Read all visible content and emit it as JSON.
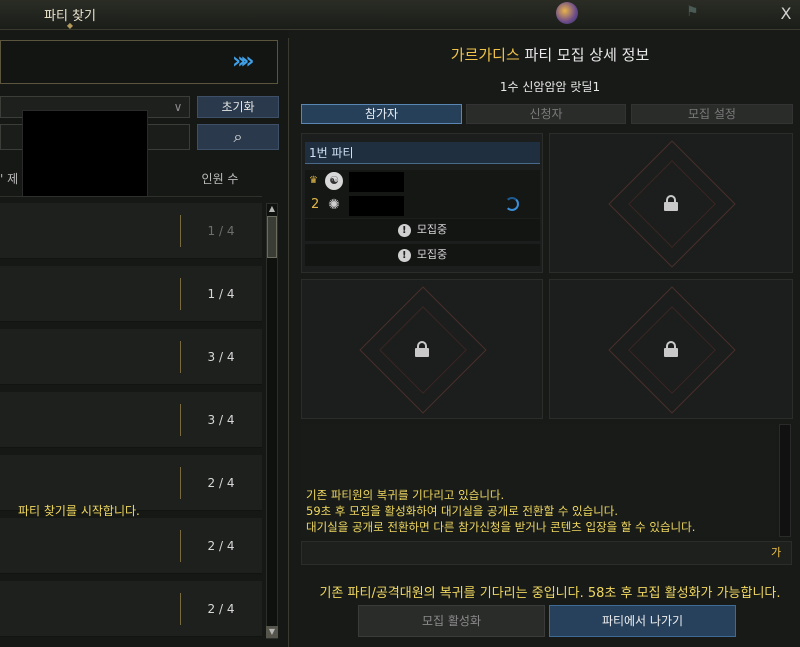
{
  "window": {
    "title": "파티 찾기",
    "title_ornament": "◆",
    "close_label": "X",
    "map_pin_glyph": "⚑"
  },
  "left": {
    "search_arrow": "»»",
    "reset_label": "초기화",
    "search_icon": "⌕",
    "filter_chevron": "∨",
    "col_title_fragment": "' 제",
    "col_members": "인원 수",
    "rows": [
      {
        "count": "1 / 4",
        "dim": true
      },
      {
        "count": "1 / 4",
        "dim": false
      },
      {
        "count": "3 / 4",
        "dim": false
      },
      {
        "count": "3 / 4",
        "dim": false
      },
      {
        "count": "2 / 4",
        "dim": false
      },
      {
        "count": "2 / 4",
        "dim": false
      },
      {
        "count": "2 / 4",
        "dim": false
      }
    ],
    "start_message": "파티 찾기를 시작합니다.",
    "scroll_up": "▲",
    "scroll_down": "▼"
  },
  "detail": {
    "title_accent": "가르가디스",
    "title_rest": " 파티 모집 상세 정보",
    "party_name": "1수 신암암암 랏딜1",
    "tabs": {
      "participants": "참가자",
      "applicants": "신청자",
      "settings": "모집 설정"
    },
    "party1": {
      "header": "1번 파티",
      "crown": "♛",
      "class_icon_1": "☯",
      "member2_number": "2",
      "class_icon_2": "✺",
      "recruit_label": "모집중",
      "excl": "!"
    },
    "messages": [
      "기존 파티원의 복귀를 기다리고 있습니다.",
      "59초 후 모집을 활성화하여 대기실을 공개로 전환할 수 있습니다.",
      "대기실을 공개로 전환하면 다른 참가신청을 받거나 콘텐츠 입장을 할 수 있습니다."
    ],
    "chat_lang": "가",
    "bottom_status": "기존 파티/공격대원의 복귀를 기다리는 중입니다. 58초 후 모집 활성화가 가능합니다.",
    "activate_label": "모집 활성화",
    "leave_label": "파티에서 나가기"
  },
  "colors": {
    "accent_gold": "#f0c24a",
    "message_yellow": "#f0d860",
    "tab_active": "#26405a",
    "arrow_blue": "#3fa0e8"
  }
}
